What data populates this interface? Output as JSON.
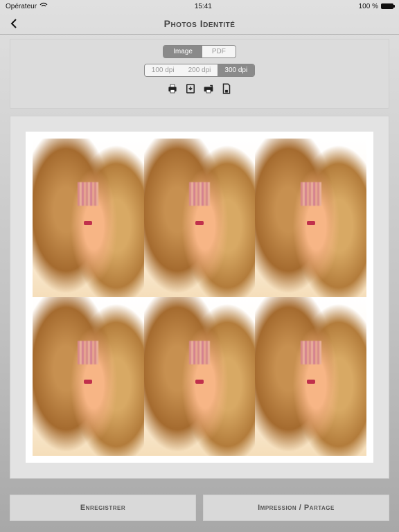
{
  "status": {
    "carrier": "Opérateur",
    "time": "15:41",
    "batteryText": "100 %"
  },
  "header": {
    "title": "Photos Identité"
  },
  "format": {
    "image": "Image",
    "pdf": "PDF",
    "selected": "Image"
  },
  "dpi": {
    "d100": "100 dpi",
    "d200": "200 dpi",
    "d300": "300 dpi",
    "selected": "300 dpi"
  },
  "toolbar": {
    "icons": [
      "printer-icon",
      "download-icon",
      "print-share-icon",
      "save-file-icon"
    ]
  },
  "preview": {
    "rows": 2,
    "cols": 3
  },
  "buttons": {
    "save": "Enregistrer",
    "printShare": "Impression / Partage"
  }
}
